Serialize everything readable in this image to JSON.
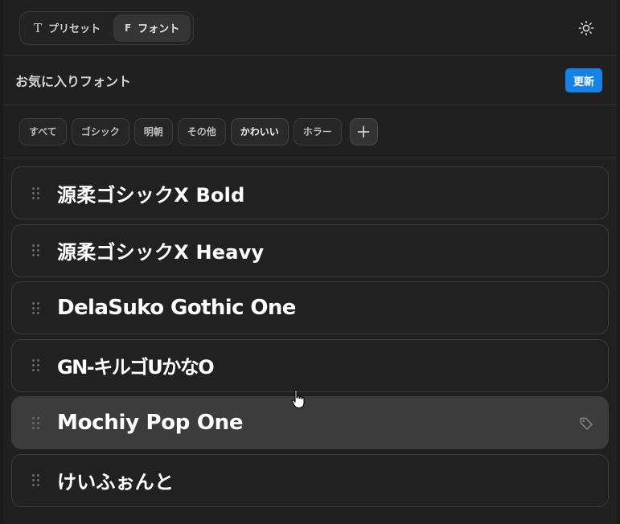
{
  "tabs": [
    {
      "icon": "T",
      "label": "プリセット",
      "active": false
    },
    {
      "icon": "F",
      "label": "フォント",
      "active": true
    }
  ],
  "header": {
    "title": "お気に入りフォント",
    "update_label": "更新"
  },
  "filters": [
    {
      "label": "すべて",
      "active": false
    },
    {
      "label": "ゴシック",
      "active": false
    },
    {
      "label": "明朝",
      "active": false
    },
    {
      "label": "その他",
      "active": false
    },
    {
      "label": "かわいい",
      "active": true
    },
    {
      "label": "ホラー",
      "active": false
    }
  ],
  "fonts": [
    {
      "name": "源柔ゴシックX Bold"
    },
    {
      "name": "源柔ゴシックX Heavy"
    },
    {
      "name": "DelaSuko Gothic One"
    },
    {
      "name": "GN-キルゴUかなO"
    },
    {
      "name": "Mochiy Pop One",
      "hovered": true
    },
    {
      "name": "けいふぉんと"
    }
  ],
  "colors": {
    "accent": "#1482e8",
    "background": "#202020",
    "row_hover": "#3c3c3c"
  },
  "icons": [
    "text-t-icon",
    "font-f-icon",
    "sun-icon",
    "plus-icon",
    "drag-handle-icon",
    "tag-icon",
    "pointer-hand-cursor"
  ]
}
